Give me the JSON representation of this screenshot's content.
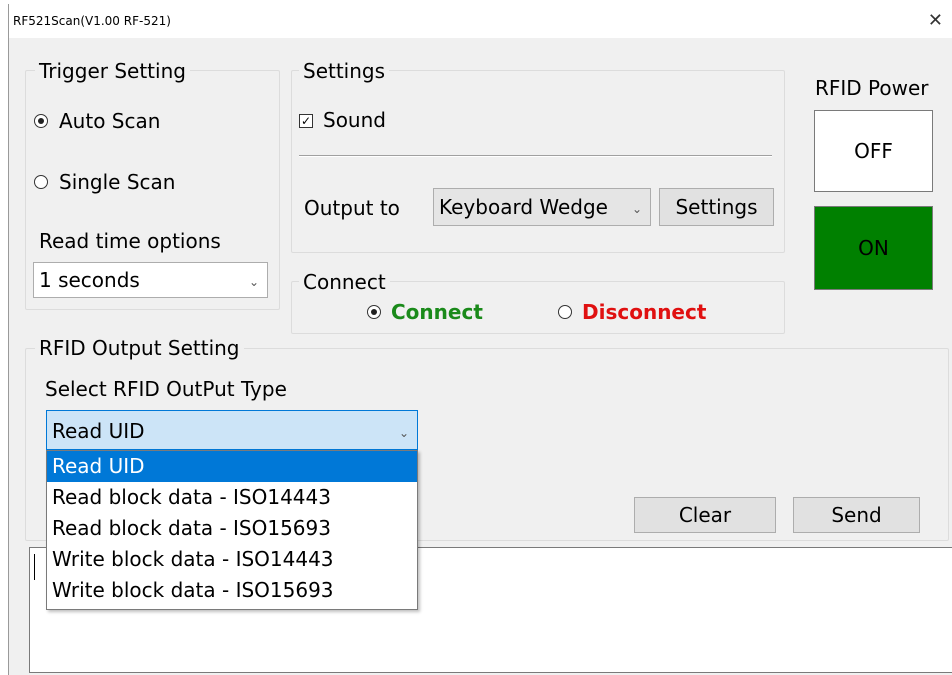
{
  "window": {
    "title": "RF521Scan(V1.00 RF-521)",
    "close_glyph": "✕"
  },
  "trigger": {
    "title": "Trigger Setting",
    "auto_scan": "Auto Scan",
    "single_scan": "Single Scan",
    "selected": "Auto Scan",
    "read_time_label": "Read time options",
    "read_time_value": "1 seconds"
  },
  "settings": {
    "title": "Settings",
    "sound_label": "Sound",
    "sound_checked": true,
    "output_label": "Output to",
    "output_value": "Keyboard Wedge",
    "settings_button": "Settings"
  },
  "power": {
    "title": "RFID Power",
    "off_label": "OFF",
    "on_label": "ON",
    "on_color": "#008000"
  },
  "connect": {
    "title": "Connect",
    "connect_label": "Connect",
    "disconnect_label": "Disconnect",
    "selected": "Connect",
    "connect_color": "#1a8a1a",
    "disconnect_color": "#e01010"
  },
  "output": {
    "title": "RFID Output Setting",
    "type_label": "Select RFID OutPut Type",
    "type_value": "Read UID",
    "options": [
      "Read UID",
      "Read block data - ISO14443",
      "Read block data - ISO15693",
      "Write block data - ISO14443",
      "Write block data - ISO15693"
    ],
    "selected_index": 0,
    "clear_button": "Clear",
    "send_button": "Send"
  },
  "log": {
    "text": ""
  }
}
